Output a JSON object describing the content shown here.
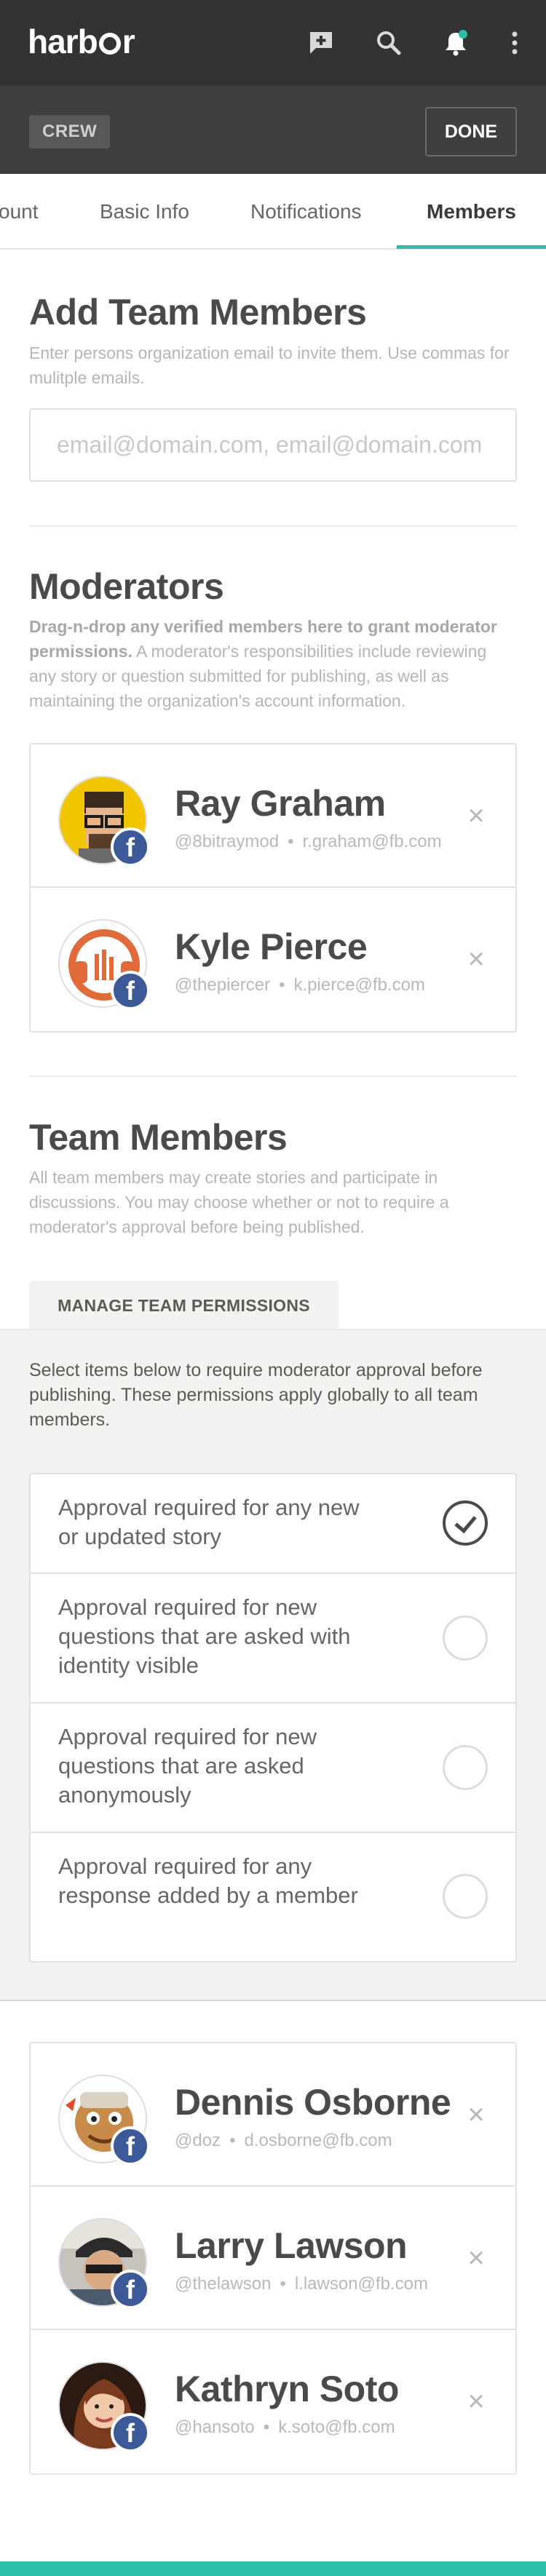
{
  "app": {
    "logo_prefix": "harb",
    "logo_suffix": "r"
  },
  "subbar": {
    "badge": "CREW",
    "done_label": "DONE"
  },
  "tabs": [
    {
      "label": "ount"
    },
    {
      "label": "Basic Info"
    },
    {
      "label": "Notifications"
    },
    {
      "label": "Members",
      "active": true
    }
  ],
  "add_members": {
    "title": "Add Team Members",
    "description": "Enter persons organization email to invite them. Use commas for mulitple emails.",
    "placeholder": "email@domain.com, email@domain.com"
  },
  "moderators": {
    "title": "Moderators",
    "description_bold": "Drag-n-drop any verified members here to grant moderator permissions.",
    "description_rest": " A moderator's responsibilities include reviewing any story or question submitted for publishing, as well as maintaining the organization's account information.",
    "members": [
      {
        "name": "Ray Graham",
        "handle": "@8bitraymod",
        "email": "r.graham@fb.com",
        "separator": "•",
        "remove": "×",
        "social": "f"
      },
      {
        "name": "Kyle Pierce",
        "handle": "@thepiercer",
        "email": "k.pierce@fb.com",
        "separator": "•",
        "remove": "×",
        "social": "f"
      }
    ]
  },
  "team_members": {
    "title": "Team Members",
    "description": "All team members may create stories and participate in discussions. You may choose whether or not to require a moderator's approval before being published.",
    "permissions_tab": "MANAGE TEAM PERMISSIONS",
    "permissions_description": "Select items below to require moderator approval before publishing. These permissions apply globally to all team members.",
    "permissions": [
      {
        "label": "Approval required for any new or updated story",
        "checked": true
      },
      {
        "label": "Approval required for new questions that are asked with identity visible",
        "checked": false
      },
      {
        "label": "Approval required for new questions that are asked anonymously",
        "checked": false
      },
      {
        "label": "Approval required for any response added by a member",
        "checked": false
      }
    ],
    "members": [
      {
        "name": "Dennis Osborne",
        "handle": "@doz",
        "email": "d.osborne@fb.com",
        "separator": "•",
        "remove": "×",
        "social": "f"
      },
      {
        "name": "Larry Lawson",
        "handle": "@thelawson",
        "email": "l.lawson@fb.com",
        "separator": "•",
        "remove": "×",
        "social": "f"
      },
      {
        "name": "Kathryn Soto",
        "handle": "@hansoto",
        "email": "k.soto@fb.com",
        "separator": "•",
        "remove": "×",
        "social": "f"
      }
    ]
  },
  "colors": {
    "accent": "#2bbfa8",
    "nav": "#333333",
    "subnav": "#3f3f3f",
    "facebook": "#3b5998"
  }
}
